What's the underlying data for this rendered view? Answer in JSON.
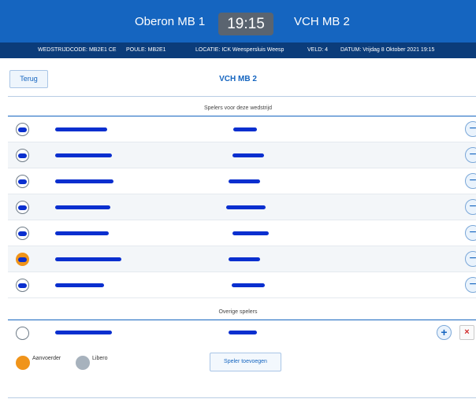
{
  "scoreboard": {
    "home_team": "Oberon MB 1",
    "time": "19:15",
    "away_team": "VCH MB 2"
  },
  "info": {
    "code": "WEDSTRIJDCODE: MB2E1 CE",
    "pool": "POULE: MB2E1",
    "location": "LOCATIE: ICK Weespersluis Weesp",
    "field": "VELD: 4",
    "date": "DATUM: Vrijdag 8 Oktober 2021 19:15"
  },
  "nav": {
    "back_label": "Terug",
    "team_title": "VCH MB 2"
  },
  "sections": {
    "match_players": "Spelers voor deze wedstrijd",
    "other_players": "Overige spelers"
  },
  "players": [
    {
      "role": "none"
    },
    {
      "role": "none"
    },
    {
      "role": "none"
    },
    {
      "role": "none"
    },
    {
      "role": "none"
    },
    {
      "role": "captain"
    },
    {
      "role": "none"
    }
  ],
  "legend": {
    "captain_label": "Aanvoerder",
    "libero_label": "Libero",
    "captain_color": "#f0941a",
    "libero_color": "#a7b2bd"
  },
  "actions": {
    "add_player_label": "Speler toevoegen",
    "remove_symbol": "−",
    "add_symbol": "+",
    "delete_symbol": "×"
  }
}
